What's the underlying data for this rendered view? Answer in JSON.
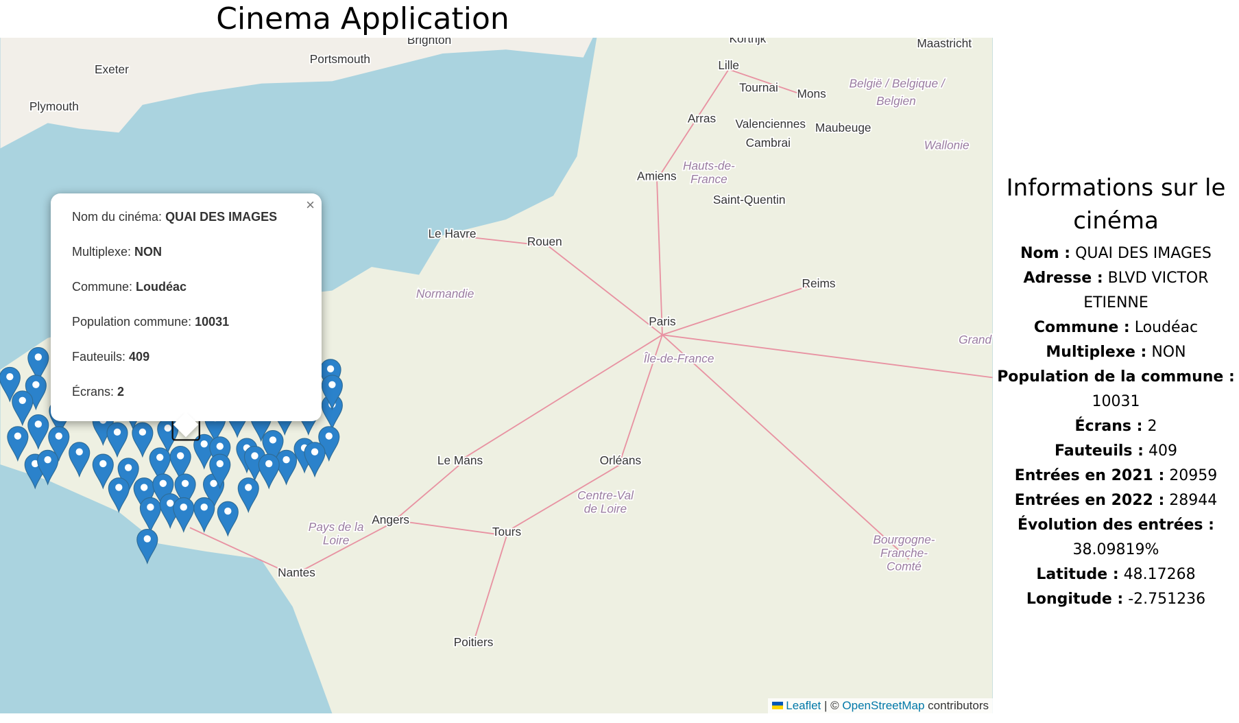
{
  "header": {
    "title": "Cinema Application"
  },
  "map": {
    "cities": [
      "Brighton",
      "Portsmouth",
      "Exeter",
      "Plymouth",
      "Kortrijk",
      "Lille",
      "Tournai",
      "Mons",
      "Maastricht",
      "Arras",
      "Valenciennes",
      "Maubeuge",
      "Cambrai",
      "Amiens",
      "Saint-Quentin",
      "Le Havre",
      "Rouen",
      "Reims",
      "Paris",
      "Le Mans",
      "Orléans",
      "Angers",
      "Tours",
      "Nantes",
      "Poitiers"
    ],
    "regions": [
      "België / Belgique /",
      "Belgien",
      "Wallonie",
      "Hauts-de-",
      "France",
      "Normandie",
      "Île-de-France",
      "Centre-Val",
      "de Loire",
      "Pays de la",
      "Loire",
      "Bourgogne-",
      "Franche-",
      "Comté",
      "Grand"
    ],
    "colors": {
      "sea": "#aad3df",
      "land": "#f2efe9",
      "marker": "#2b82cb"
    },
    "attribution": {
      "leaflet": "Leaflet",
      "separator": "| ©",
      "osm": "OpenStreetMap",
      "suffix": "contributors"
    }
  },
  "popup": {
    "close": "×",
    "rows": [
      {
        "label": "Nom du cinéma: ",
        "value": "QUAI DES IMAGES"
      },
      {
        "label": "Multiplexe: ",
        "value": "NON"
      },
      {
        "label": "Commune: ",
        "value": "Loudéac"
      },
      {
        "label": "Population commune: ",
        "value": "10031"
      },
      {
        "label": "Fauteuils: ",
        "value": "409"
      },
      {
        "label": "Écrans: ",
        "value": "2"
      }
    ]
  },
  "sidebar": {
    "title": "Informations sur le cinéma",
    "fields": [
      {
        "label": "Nom :",
        "value": "QUAI DES IMAGES"
      },
      {
        "label": "Adresse :",
        "value": "BLVD VICTOR ETIENNE"
      },
      {
        "label": "Commune :",
        "value": "Loudéac"
      },
      {
        "label": "Multiplexe :",
        "value": "NON"
      },
      {
        "label": "Population de la commune :",
        "value": "10031"
      },
      {
        "label": "Écrans :",
        "value": "2"
      },
      {
        "label": "Fauteuils :",
        "value": "409"
      },
      {
        "label": "Entrées en 2021 :",
        "value": "20959"
      },
      {
        "label": "Entrées en 2022 :",
        "value": "28944"
      },
      {
        "label": "Évolution des entrées :",
        "value": "38.09819%"
      },
      {
        "label": "Latitude :",
        "value": "48.17268"
      },
      {
        "label": "Longitude :",
        "value": "-2.751236"
      }
    ]
  }
}
